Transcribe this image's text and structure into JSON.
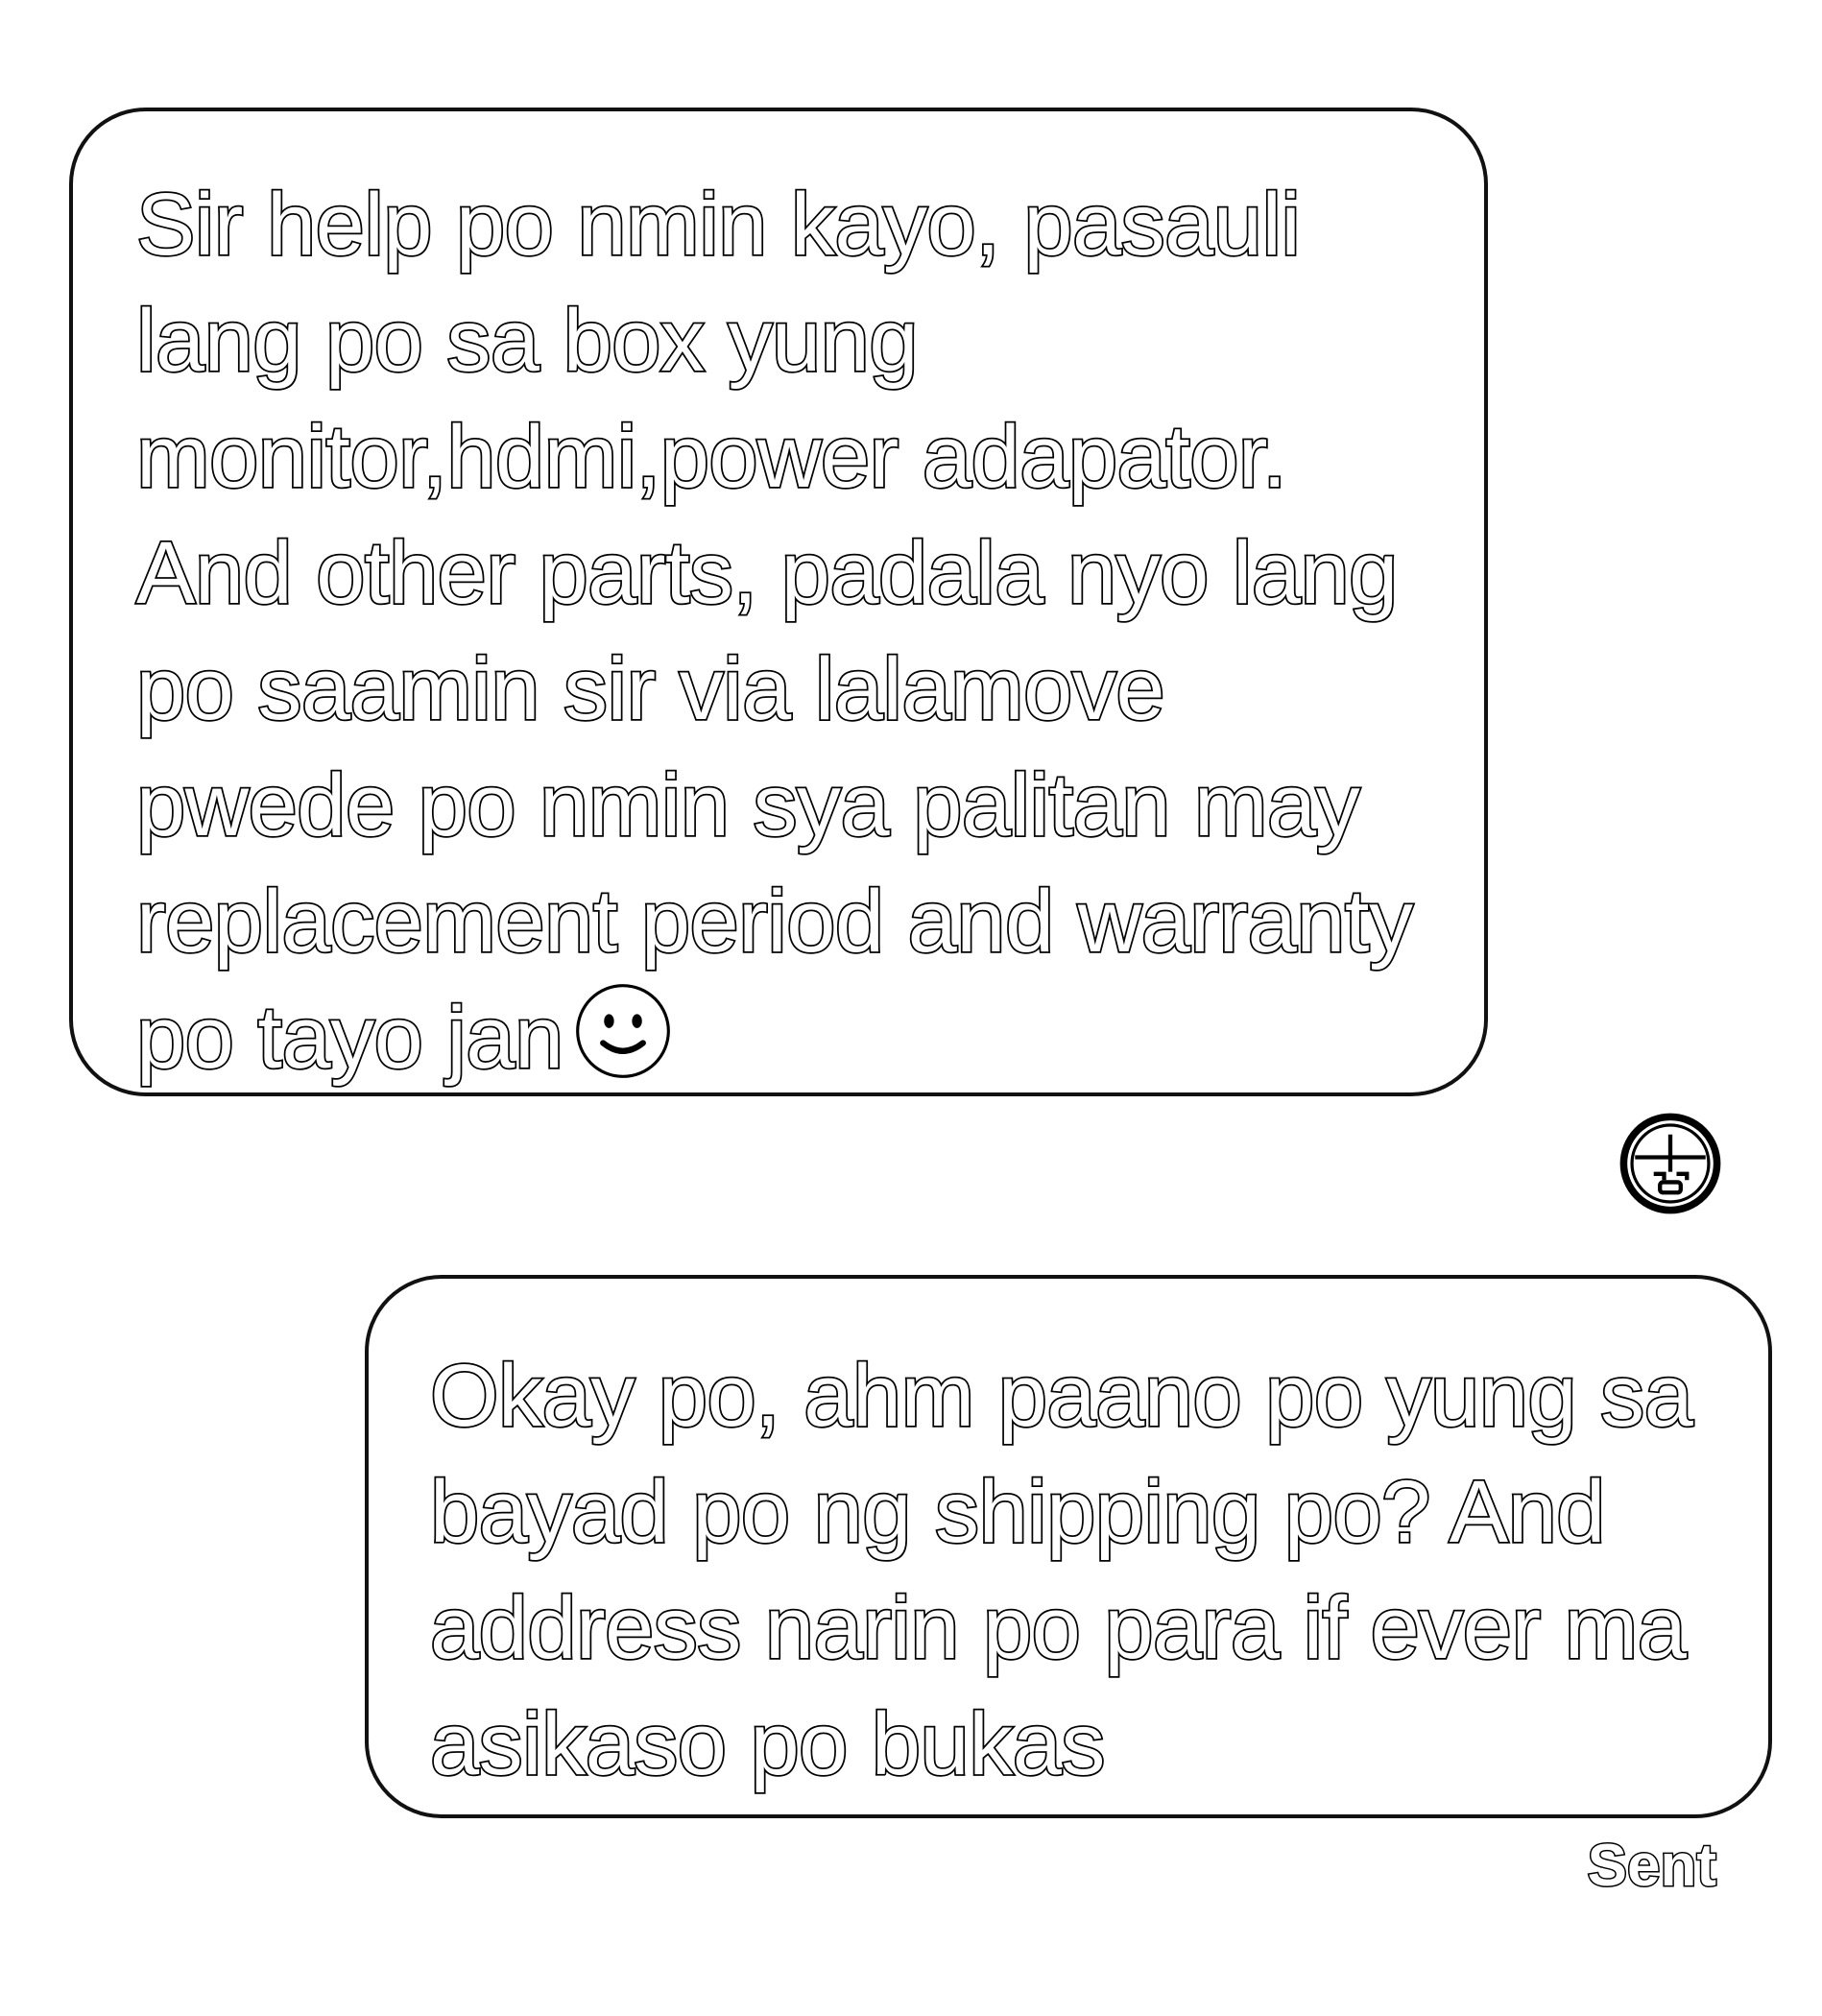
{
  "conversation": {
    "messages": [
      {
        "direction": "incoming",
        "text": "Sir help po nmin kayo, pasauli lang po sa box yung monitor,hdmi,power adapator. And other parts, padala nyo lang po saamin sir via lalamove pwede po nmin sya palitan may replacement period and warranty po tayo jan",
        "trailing_icon": "smiley-icon"
      },
      {
        "direction": "outgoing",
        "text": "Okay po, ahm paano po yung sa bayad po ng shipping po? And address narin po para if ever ma asikaso po bukas",
        "status": "Sent"
      }
    ],
    "sender_avatar_icon": "avatar-face-icon"
  }
}
